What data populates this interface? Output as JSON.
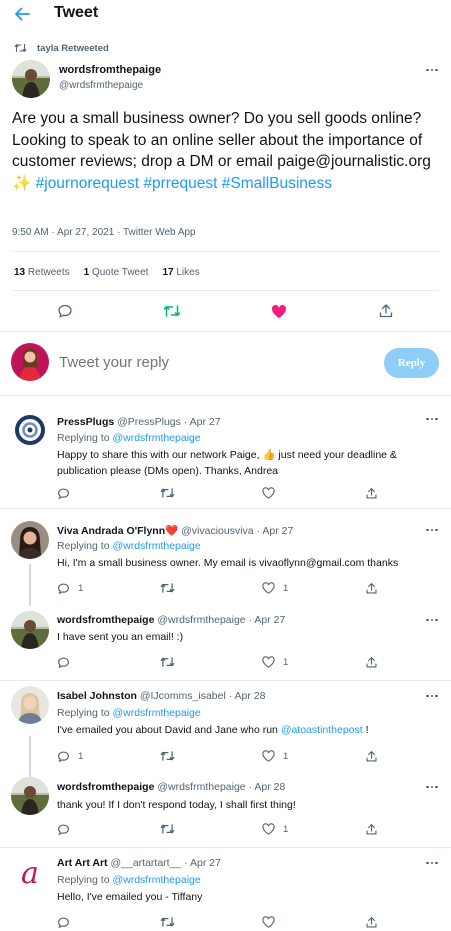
{
  "header": {
    "title": "Tweet"
  },
  "main_tweet": {
    "retweeted_by": "tayla Retweeted",
    "author_name": "wordsfromthepaige",
    "author_handle": "@wrdsfrmthepaige",
    "text_plain": "Are you a small business owner? Do you sell goods online? Looking to speak to an online seller about the importance of customer reviews; drop a DM or email paige@journalistic.org ",
    "emoji": "✨",
    "hashtags": [
      "#journorequest",
      "#prrequest",
      "#SmallBusiness"
    ],
    "timestamp": "9:50 AM · Apr 27, 2021 · Twitter Web App",
    "stats": {
      "retweets_count": "13",
      "retweets_label": "Retweets",
      "quotes_count": "1",
      "quotes_label": "Quote Tweet",
      "likes_count": "17",
      "likes_label": "Likes"
    }
  },
  "composer": {
    "placeholder": "Tweet your reply",
    "button_label": "Reply"
  },
  "replies": [
    {
      "name": "PressPlugs",
      "meta": "@PressPlugs · Apr 27",
      "replying_prefix": "Replying to",
      "replying_to": "@wrdsfrmthepaige",
      "text_1": "Happy to share this with our network Paige, ",
      "emoji": "👍",
      "text_2": " just need your deadline & publication please (DMs open). Thanks, Andrea",
      "replies_count": "",
      "likes_count": ""
    },
    {
      "name": "Viva Andrada O'Flynn",
      "name_emoji": "❤️",
      "meta": "@vivaciousviva · Apr 27",
      "replying_prefix": "Replying to",
      "replying_to": "@wrdsfrmthepaige",
      "text": "Hi, I'm a small business owner. My email is vivaoflynn@gmail.com thanks",
      "replies_count": "1",
      "likes_count": "1"
    },
    {
      "name": "wordsfromthepaige",
      "meta": "@wrdsfrmthepaige · Apr 27",
      "text": "I have sent you an email! :)",
      "replies_count": "",
      "likes_count": "1"
    },
    {
      "name": "Isabel Johnston",
      "meta": "@IJcomms_isabel · Apr 28",
      "replying_prefix": "Replying to",
      "replying_to": "@wrdsfrmthepaige",
      "text_1": "I've emailed you about David and Jane who run ",
      "mention": "@atoastinthepost",
      "text_2": " !",
      "replies_count": "1",
      "likes_count": "1"
    },
    {
      "name": "wordsfromthepaige",
      "meta": "@wrdsfrmthepaige · Apr 28",
      "text": "thank you! If I don't respond today, I shall first thing!",
      "replies_count": "",
      "likes_count": "1"
    },
    {
      "name": "Art Art Art",
      "meta": "@__artartart__ · Apr 27",
      "replying_prefix": "Replying to",
      "replying_to": "@wrdsfrmthepaige",
      "text": "Hello, I've emailed you - Tiffany",
      "replies_count": "",
      "likes_count": ""
    }
  ],
  "colors": {
    "accent": "#1d9bf0",
    "like_active": "#f91880",
    "retweet_active": "#00ba7c",
    "reply_button": "#8ecdf8"
  },
  "icons": [
    "back-arrow-icon",
    "retweet-icon",
    "more-icon",
    "reply-icon",
    "like-icon",
    "share-icon"
  ]
}
